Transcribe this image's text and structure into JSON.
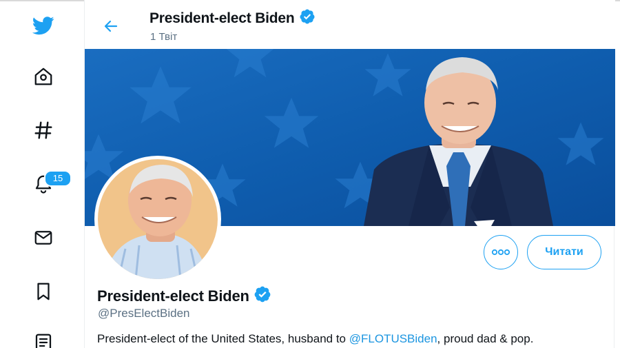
{
  "colors": {
    "accent": "#1da1f2",
    "banner_blue": "#0d5fb3",
    "muted_text": "#5b7083"
  },
  "nav": {
    "items": [
      {
        "icon": "twitter-bird-icon"
      },
      {
        "icon": "home-icon"
      },
      {
        "icon": "hashtag-icon"
      },
      {
        "icon": "bell-icon",
        "badge": "15"
      },
      {
        "icon": "mail-icon"
      },
      {
        "icon": "bookmark-icon"
      },
      {
        "icon": "list-icon"
      }
    ]
  },
  "header": {
    "title": "President-elect Biden",
    "tweet_count": "1 Твіт"
  },
  "profile": {
    "name": "President-elect Biden",
    "handle": "@PresElectBiden",
    "bio_before": "President-elect of the United States, husband to ",
    "bio_mention": "@FLOTUSBiden",
    "bio_after": ", proud dad & pop.",
    "follow_label": "Читати",
    "more_icon": "more-options-icon",
    "verified_icon": "verified-badge-icon"
  }
}
